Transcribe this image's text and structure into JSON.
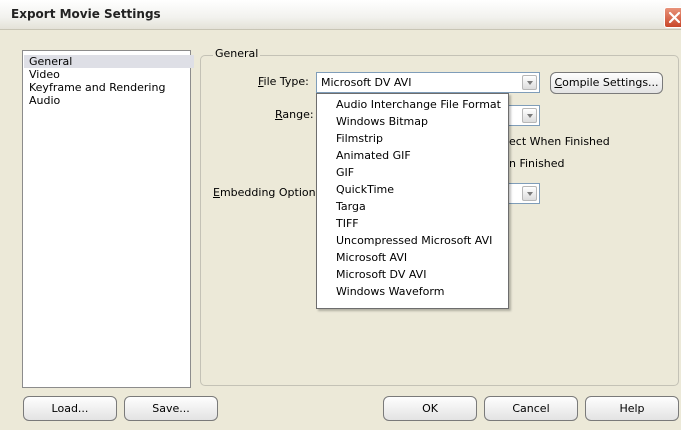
{
  "window": {
    "title": "Export Movie Settings"
  },
  "sidebar": {
    "items": [
      {
        "label": "General",
        "selected": true
      },
      {
        "label": "Video",
        "selected": false
      },
      {
        "label": "Keyframe and Rendering",
        "selected": false
      },
      {
        "label": "Audio",
        "selected": false
      }
    ]
  },
  "general": {
    "group_label": "General",
    "file_type_label_u": "F",
    "file_type_label_rest": "ile Type:",
    "file_type_value": "Microsoft DV AVI",
    "compile_settings_u": "C",
    "compile_settings_rest": "ompile Settings...",
    "range_label_u": "R",
    "range_label_rest": "ange:",
    "embedding_label_u": "E",
    "embedding_label_rest": "mbedding Options:",
    "hidden_option_1_visible": "ect When Finished",
    "hidden_option_2_visible": "n Finished"
  },
  "dropdown": {
    "options": [
      "Audio Interchange File Format",
      "Windows Bitmap",
      "Filmstrip",
      "Animated GIF",
      "GIF",
      "QuickTime",
      "Targa",
      "TIFF",
      "Uncompressed Microsoft AVI",
      "Microsoft AVI",
      "Microsoft DV AVI",
      "Windows Waveform"
    ]
  },
  "buttons": {
    "load": "Load...",
    "save": "Save...",
    "ok": "OK",
    "cancel": "Cancel",
    "help": "Help"
  },
  "icons": {
    "close": "close-icon",
    "dropdown": "chevron-down-icon"
  },
  "colors": {
    "close_button": "#c9472a",
    "selection": "#dedfe6",
    "field_border": "#7f9db9"
  }
}
